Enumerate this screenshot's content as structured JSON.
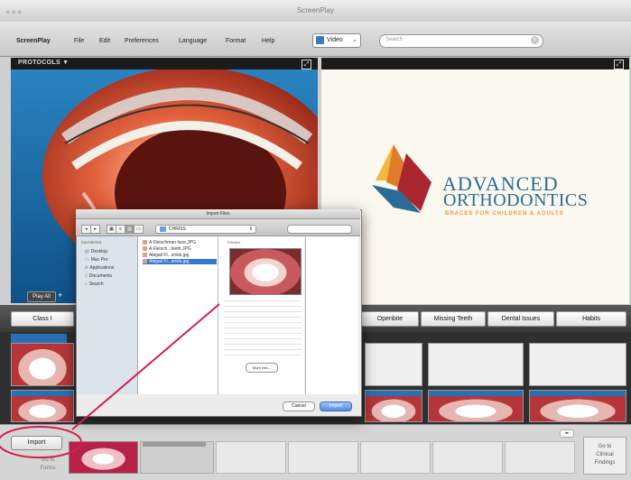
{
  "window": {
    "title": "ScreenPlay"
  },
  "menu": [
    "ScreenPlay",
    "File",
    "Edit",
    "Preferences",
    "Language",
    "Format",
    "Help"
  ],
  "toolbar": {
    "view_select": "Video",
    "search_placeholder": "Search"
  },
  "left_panel": {
    "dropdown_label": "PROTOCOLS",
    "play_all": "Play All"
  },
  "right_panel": {
    "brand_line1": "ADVANCED",
    "brand_line2": "ORTHODONTICS",
    "brand_tagline": "BRACES FOR CHILDREN & ADULTS"
  },
  "categories": [
    "Class I",
    "Openbite",
    "Missing Teeth",
    "Dental Issues",
    "Habits"
  ],
  "bottom": {
    "import_label": "Import",
    "goto_forms": [
      "Go to",
      "Forms"
    ],
    "goto_clinical": [
      "Go to",
      "Clinical",
      "Findings"
    ]
  },
  "dialog": {
    "title": "Import Files",
    "folder": "CHRISS",
    "sidebar_header": "FAVORITES",
    "sidebar": [
      "Desktop",
      "Mac Pro",
      "Applications",
      "Documents",
      "Search"
    ],
    "files": [
      "A Fleischman face.JPG",
      "A Fleisch...teeth.JPG",
      "Abigail Fl...smile.jpg",
      "Abigail Fl...smile.jpg"
    ],
    "preview_label": "Preview",
    "more_info": "More Info...",
    "cancel": "Cancel",
    "import": "Import"
  },
  "colors": {
    "accent": "#2a6fb3",
    "brand": "#2a6c93",
    "annotation": "#d31f4e"
  }
}
